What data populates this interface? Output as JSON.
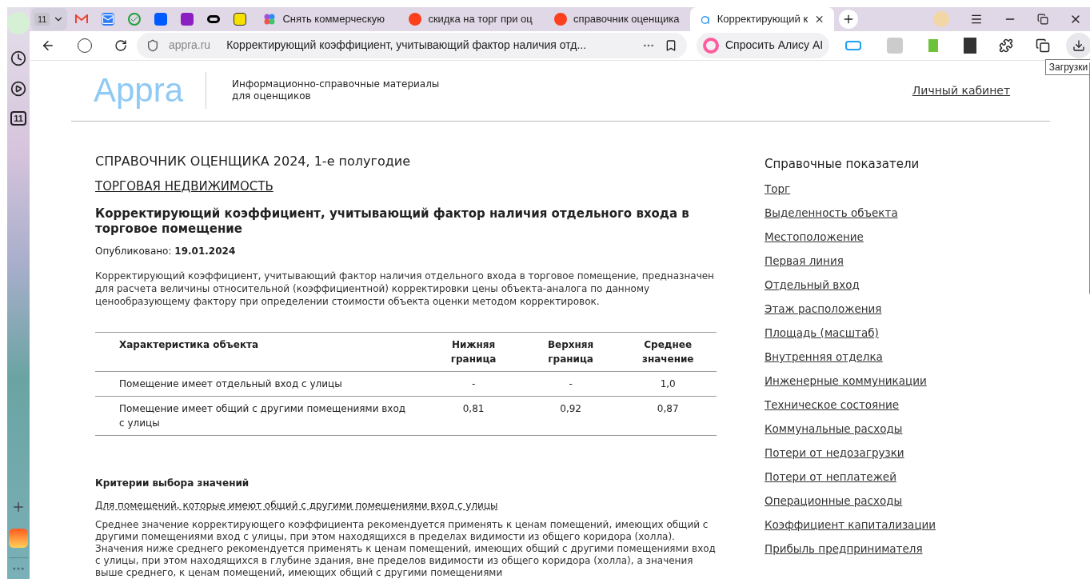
{
  "browser": {
    "workspace_badge": "11",
    "tabs": [
      {
        "kind": "pinned"
      },
      {
        "kind": "pinned"
      },
      {
        "kind": "pinned"
      },
      {
        "kind": "pinned"
      },
      {
        "kind": "pinned"
      },
      {
        "kind": "pinned"
      },
      {
        "kind": "pinned"
      },
      {
        "kind": "page",
        "title": "Снять коммерческую",
        "selected": false
      },
      {
        "kind": "page",
        "title": "скидка на торг при оц",
        "selected": false
      },
      {
        "kind": "page",
        "title": "справочник оценщика",
        "selected": false
      },
      {
        "kind": "page",
        "title": "Корректирующий к",
        "selected": true
      }
    ],
    "domain": "appra.ru",
    "page_title": "Корректирующий коэффициент, учитывающий фактор наличия отд...",
    "alice_button": "Спросить Алису AI",
    "tooltip": "Загрузки",
    "sidebar_badge": "11"
  },
  "site": {
    "logo": "Appra",
    "tagline": "Информационно-справочные материалы для оценщиков",
    "account_link": "Личный кабинет"
  },
  "article": {
    "heading": "СПРАВОЧНИК ОЦЕНЩИКА 2024, 1-е полугодие",
    "category_link": "ТОРГОВАЯ НЕДВИЖИМОСТЬ",
    "title": "Корректирующий коэффициент, учитывающий фактор наличия отдельного входа в торговое помещение",
    "published_label": "Опубликовано:",
    "published_date": "19.01.2024",
    "intro": "Корректирующий коэффициент, учитывающий фактор наличия отдельного входа в торговое помещение, предназначен для расчета величины относительной (коэффициентной) корректировки цены объекта-аналога по данному ценообразующему фактору при определении стоимости объекта оценки методом корректировок.",
    "table": {
      "columns": [
        "Характеристика объекта",
        "Нижняя граница",
        "Верхняя граница",
        "Среднее значение"
      ],
      "rows": [
        [
          "Помещение имеет отдельный вход с улицы",
          "-",
          "-",
          "1,0"
        ],
        [
          "Помещение имеет общий с другими помещениями вход с улицы",
          "0,81",
          "0,92",
          "0,87"
        ]
      ]
    },
    "criteria_heading": "Критерии выбора значений",
    "criteria_link": "Для помещений, которые имеют общий с другими помещениями вход с улицы",
    "criteria_text": "Среднее значение корректирующего коэффициента рекомендуется применять к ценам помещений, имеющих общий с другими помещениями вход с улицы, при этом находящихся в пределах видимости из общего коридора (холла). Значения ниже среднего рекомендуется применять к ценам помещений, имеющих общий с другими помещениями вход с улицы, при этом находящихся в глубине здания, вне пределов видимости из общего коридора (холла), а значения выше среднего, к ценам помещений, имеющих общий с другими помещениями"
  },
  "reference_sidebar": {
    "title": "Справочные показатели",
    "items": [
      "Торг",
      "Выделенность объекта",
      "Местоположение",
      "Первая линия",
      "Отдельный вход",
      "Этаж расположения",
      "Площадь (масштаб)",
      "Внутренняя отделка",
      "Инженерные коммуникации",
      "Техническое состояние",
      "Коммунальные расходы",
      "Потери от недозагрузки",
      "Потери от неплатежей",
      "Операционные расходы",
      "Коэффициент капитализации",
      "Прибыль предпринимателя"
    ]
  }
}
